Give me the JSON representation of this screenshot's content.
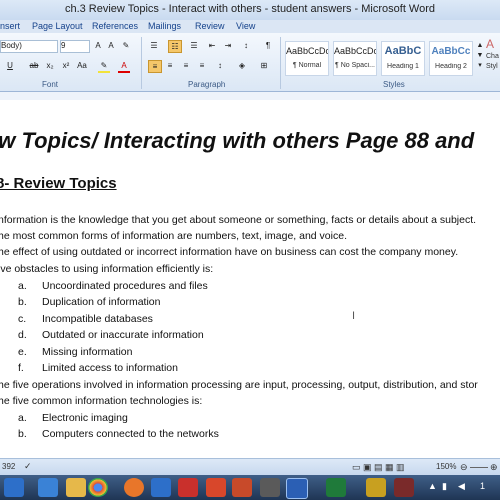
{
  "window": {
    "title": "ch.3 Review Topics - Interact with others - student answers - Microsoft Word"
  },
  "ribbon_tabs": [
    "nsert",
    "Page Layout",
    "References",
    "Mailings",
    "Review",
    "View"
  ],
  "font": {
    "name": "Body)",
    "size": "9"
  },
  "groups": {
    "font": "Font",
    "paragraph": "Paragraph",
    "styles": "Styles"
  },
  "styles": [
    {
      "sample": "AaBbCcDc",
      "name": "¶ Normal"
    },
    {
      "sample": "AaBbCcDc",
      "name": "¶ No Spaci..."
    },
    {
      "sample": "AaBbC",
      "name": "Heading 1"
    },
    {
      "sample": "AaBbCc",
      "name": "Heading 2"
    }
  ],
  "change_styles": {
    "line1": "Cha",
    "line2": "Styl"
  },
  "document": {
    "heading": "ew Topics/ Interacting with others Page 88 and",
    "subheading": "8- Review Topics",
    "lines": [
      "nformation is the knowledge that you get about someone or something, facts or details about a subject.",
      "he most common forms of information are numbers, text, image, and voice.",
      "he effect of using outdated or incorrect information have on business can cost the company money.",
      "ive obstacles to using information efficiently is:"
    ],
    "obstacles": [
      {
        "mark": "a.",
        "text": "Uncoordinated procedures and files"
      },
      {
        "mark": "b.",
        "text": "Duplication of information"
      },
      {
        "mark": "c.",
        "text": "Incompatible databases"
      },
      {
        "mark": "d.",
        "text": "Outdated or inaccurate information"
      },
      {
        "mark": "e.",
        "text": "Missing information"
      },
      {
        "mark": "f.",
        "text": "Limited access to information"
      }
    ],
    "lines2": [
      "he five operations involved in information processing are input, processing, output, distribution, and stor",
      "he five common information technologies is:"
    ],
    "technologies": [
      {
        "mark": "a.",
        "text": "Electronic imaging"
      },
      {
        "mark": "b.",
        "text": "Computers connected to the networks"
      }
    ]
  },
  "status": {
    "words": "392",
    "zoom": "150%"
  },
  "tray": {
    "time": "1"
  }
}
